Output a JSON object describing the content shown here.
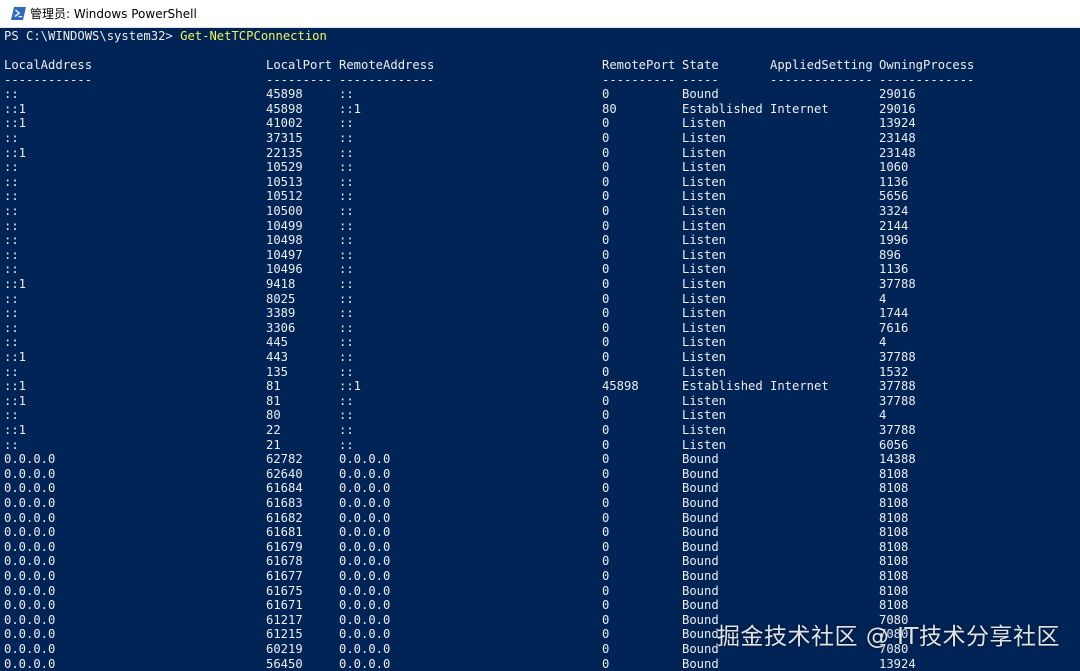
{
  "window": {
    "title": "管理员: Windows PowerShell",
    "icon": "powershell-icon",
    "colors": {
      "background": "#012456",
      "text": "#eeedf0",
      "command": "#f2f25e"
    }
  },
  "console": {
    "prompt": "PS C:\\WINDOWS\\system32> ",
    "command": "Get-NetTCPConnection",
    "headers": [
      "LocalAddress",
      "LocalPort",
      "RemoteAddress",
      "RemotePort",
      "State",
      "AppliedSetting",
      "OwningProcess"
    ],
    "underlines": [
      "------------",
      "---------",
      "-------------",
      "----------",
      "-----",
      "--------------",
      "-------------"
    ],
    "rows": [
      [
        "::",
        "45898",
        "::",
        "0",
        "Bound",
        "",
        "29016"
      ],
      [
        "::1",
        "45898",
        "::1",
        "80",
        "Established",
        "Internet",
        "29016"
      ],
      [
        "::1",
        "41002",
        "::",
        "0",
        "Listen",
        "",
        "13924"
      ],
      [
        "::",
        "37315",
        "::",
        "0",
        "Listen",
        "",
        "23148"
      ],
      [
        "::1",
        "22135",
        "::",
        "0",
        "Listen",
        "",
        "23148"
      ],
      [
        "::",
        "10529",
        "::",
        "0",
        "Listen",
        "",
        "1060"
      ],
      [
        "::",
        "10513",
        "::",
        "0",
        "Listen",
        "",
        "1136"
      ],
      [
        "::",
        "10512",
        "::",
        "0",
        "Listen",
        "",
        "5656"
      ],
      [
        "::",
        "10500",
        "::",
        "0",
        "Listen",
        "",
        "3324"
      ],
      [
        "::",
        "10499",
        "::",
        "0",
        "Listen",
        "",
        "2144"
      ],
      [
        "::",
        "10498",
        "::",
        "0",
        "Listen",
        "",
        "1996"
      ],
      [
        "::",
        "10497",
        "::",
        "0",
        "Listen",
        "",
        "896"
      ],
      [
        "::",
        "10496",
        "::",
        "0",
        "Listen",
        "",
        "1136"
      ],
      [
        "::1",
        "9418",
        "::",
        "0",
        "Listen",
        "",
        "37788"
      ],
      [
        "::",
        "8025",
        "::",
        "0",
        "Listen",
        "",
        "4"
      ],
      [
        "::",
        "3389",
        "::",
        "0",
        "Listen",
        "",
        "1744"
      ],
      [
        "::",
        "3306",
        "::",
        "0",
        "Listen",
        "",
        "7616"
      ],
      [
        "::",
        "445",
        "::",
        "0",
        "Listen",
        "",
        "4"
      ],
      [
        "::1",
        "443",
        "::",
        "0",
        "Listen",
        "",
        "37788"
      ],
      [
        "::",
        "135",
        "::",
        "0",
        "Listen",
        "",
        "1532"
      ],
      [
        "::1",
        "81",
        "::1",
        "45898",
        "Established",
        "Internet",
        "37788"
      ],
      [
        "::1",
        "81",
        "::",
        "0",
        "Listen",
        "",
        "37788"
      ],
      [
        "::",
        "80",
        "::",
        "0",
        "Listen",
        "",
        "4"
      ],
      [
        "::1",
        "22",
        "::",
        "0",
        "Listen",
        "",
        "37788"
      ],
      [
        "::",
        "21",
        "::",
        "0",
        "Listen",
        "",
        "6056"
      ],
      [
        "0.0.0.0",
        "62782",
        "0.0.0.0",
        "0",
        "Bound",
        "",
        "14388"
      ],
      [
        "0.0.0.0",
        "62640",
        "0.0.0.0",
        "0",
        "Bound",
        "",
        "8108"
      ],
      [
        "0.0.0.0",
        "61684",
        "0.0.0.0",
        "0",
        "Bound",
        "",
        "8108"
      ],
      [
        "0.0.0.0",
        "61683",
        "0.0.0.0",
        "0",
        "Bound",
        "",
        "8108"
      ],
      [
        "0.0.0.0",
        "61682",
        "0.0.0.0",
        "0",
        "Bound",
        "",
        "8108"
      ],
      [
        "0.0.0.0",
        "61681",
        "0.0.0.0",
        "0",
        "Bound",
        "",
        "8108"
      ],
      [
        "0.0.0.0",
        "61679",
        "0.0.0.0",
        "0",
        "Bound",
        "",
        "8108"
      ],
      [
        "0.0.0.0",
        "61678",
        "0.0.0.0",
        "0",
        "Bound",
        "",
        "8108"
      ],
      [
        "0.0.0.0",
        "61677",
        "0.0.0.0",
        "0",
        "Bound",
        "",
        "8108"
      ],
      [
        "0.0.0.0",
        "61675",
        "0.0.0.0",
        "0",
        "Bound",
        "",
        "8108"
      ],
      [
        "0.0.0.0",
        "61671",
        "0.0.0.0",
        "0",
        "Bound",
        "",
        "8108"
      ],
      [
        "0.0.0.0",
        "61217",
        "0.0.0.0",
        "0",
        "Bound",
        "",
        "7080"
      ],
      [
        "0.0.0.0",
        "61215",
        "0.0.0.0",
        "0",
        "Bound",
        "",
        "7080"
      ],
      [
        "0.0.0.0",
        "60219",
        "0.0.0.0",
        "0",
        "Bound",
        "",
        "7080"
      ],
      [
        "0.0.0.0",
        "56450",
        "0.0.0.0",
        "0",
        "Bound",
        "",
        "13924"
      ]
    ]
  },
  "watermark": "掘金技术社区 @ IT技术分享社区"
}
